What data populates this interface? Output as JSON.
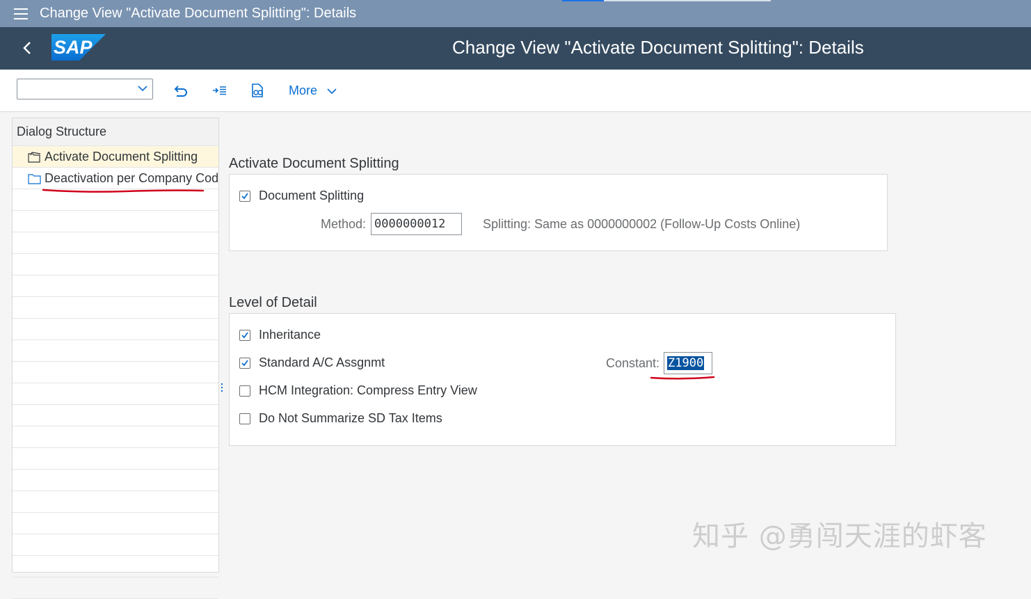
{
  "window": {
    "title": "Change View \"Activate Document Splitting\": Details"
  },
  "header": {
    "logo_text": "SAP",
    "title": "Change View \"Activate Document Splitting\": Details"
  },
  "toolbar": {
    "command_value": "",
    "more_label": "More"
  },
  "dialog_structure": {
    "title": "Dialog Structure",
    "items": [
      {
        "label": "Activate Document Splitting",
        "selected": true,
        "icon": "folder-open-icon"
      },
      {
        "label": "Deactivation per Company Code",
        "selected": false,
        "icon": "folder-icon"
      }
    ]
  },
  "activate_group": {
    "title": "Activate Document Splitting",
    "document_splitting": {
      "label": "Document Splitting",
      "checked": true
    },
    "method": {
      "label": "Method:",
      "value": "0000000012",
      "description": "Splitting: Same as 0000000002 (Follow-Up Costs Online)"
    }
  },
  "detail_group": {
    "title": "Level of Detail",
    "inheritance": {
      "label": "Inheritance",
      "checked": true
    },
    "standard_ac": {
      "label": "Standard A/C Assgnmt",
      "checked": true
    },
    "hcm": {
      "label": "HCM Integration: Compress Entry View",
      "checked": false
    },
    "sd_tax": {
      "label": "Do Not Summarize SD Tax Items",
      "checked": false
    },
    "constant": {
      "label": "Constant:",
      "value": "Z1900"
    }
  },
  "watermark": "知乎 @勇闯天涯的虾客",
  "colors": {
    "shell": "#354a5f",
    "titlebar": "#7a93b1",
    "accent": "#0a6ed1",
    "annotation": "#d0021b"
  }
}
